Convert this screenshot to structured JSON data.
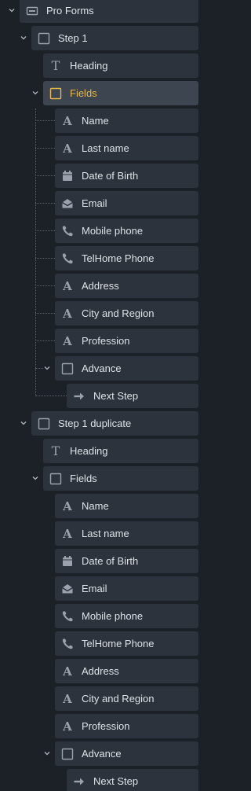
{
  "colors": {
    "background": "#1c2127",
    "node": "#2c333c",
    "node_selected": "#3c4550",
    "selected_text": "#e8b84a",
    "icon": "#9aa3ad",
    "text": "#dfe3e8"
  },
  "tree": {
    "root": {
      "label": "Pro Forms",
      "icon": "form-icon"
    },
    "step1": {
      "label": "Step 1",
      "icon": "square-icon",
      "heading": {
        "label": "Heading",
        "icon": "text-type-icon"
      },
      "fields": {
        "label": "Fields",
        "icon": "square-icon",
        "selected": true,
        "items": [
          {
            "label": "Name",
            "icon": "text-field-icon"
          },
          {
            "label": "Last name",
            "icon": "text-field-icon"
          },
          {
            "label": "Date of Birth",
            "icon": "calendar-icon"
          },
          {
            "label": "Email",
            "icon": "envelope-icon"
          },
          {
            "label": "Mobile phone",
            "icon": "phone-icon"
          },
          {
            "label": "TelHome Phone",
            "icon": "phone-icon"
          },
          {
            "label": "Address",
            "icon": "text-field-icon"
          },
          {
            "label": "City and Region",
            "icon": "text-field-icon"
          },
          {
            "label": "Profession",
            "icon": "text-field-icon"
          }
        ],
        "advance": {
          "label": "Advance",
          "icon": "square-icon",
          "next": {
            "label": "Next Step",
            "icon": "arrow-right-icon"
          }
        }
      }
    },
    "step1dup": {
      "label": "Step 1 duplicate",
      "icon": "square-icon",
      "heading": {
        "label": "Heading",
        "icon": "text-type-icon"
      },
      "fields": {
        "label": "Fields",
        "icon": "square-icon",
        "selected": false,
        "items": [
          {
            "label": "Name",
            "icon": "text-field-icon"
          },
          {
            "label": "Last name",
            "icon": "text-field-icon"
          },
          {
            "label": "Date of Birth",
            "icon": "calendar-icon"
          },
          {
            "label": "Email",
            "icon": "envelope-icon"
          },
          {
            "label": "Mobile phone",
            "icon": "phone-icon"
          },
          {
            "label": "TelHome Phone",
            "icon": "phone-icon"
          },
          {
            "label": "Address",
            "icon": "text-field-icon"
          },
          {
            "label": "City and Region",
            "icon": "text-field-icon"
          },
          {
            "label": "Profession",
            "icon": "text-field-icon"
          }
        ],
        "advance": {
          "label": "Advance",
          "icon": "square-icon",
          "next": {
            "label": "Next Step",
            "icon": "arrow-right-icon"
          }
        }
      }
    }
  }
}
